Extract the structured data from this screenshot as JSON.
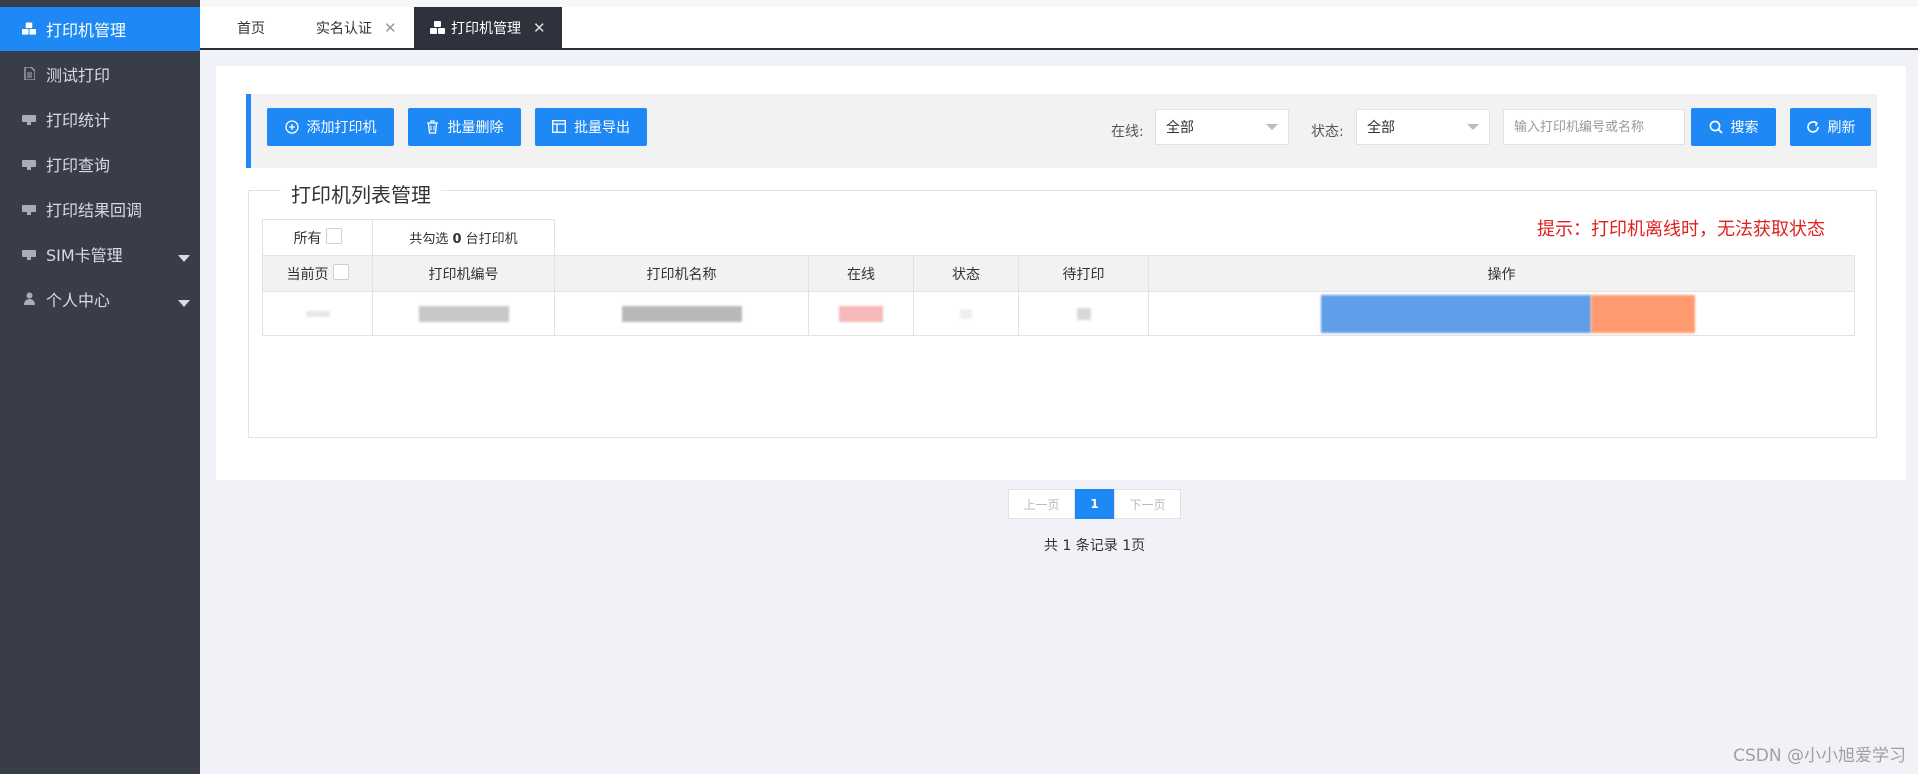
{
  "sidebar": {
    "items": [
      {
        "label": "打印机管理",
        "icon": "cubes-icon",
        "active": true
      },
      {
        "label": "测试打印",
        "icon": "file-icon"
      },
      {
        "label": "打印统计",
        "icon": "printer-icon"
      },
      {
        "label": "打印查询",
        "icon": "printer-icon"
      },
      {
        "label": "打印结果回调",
        "icon": "printer-icon"
      },
      {
        "label": "SIM卡管理",
        "icon": "printer-icon",
        "expandable": true
      },
      {
        "label": "个人中心",
        "icon": "user-icon",
        "expandable": true
      }
    ]
  },
  "tabs": [
    {
      "label": "首页"
    },
    {
      "label": "实名认证",
      "closable": true
    },
    {
      "label": "打印机管理",
      "closable": true,
      "active": true
    }
  ],
  "toolbar": {
    "add_label": "添加打印机",
    "delete_label": "批量删除",
    "export_label": "批量导出",
    "online_label": "在线:",
    "online_value": "全部",
    "status_label": "状态:",
    "status_value": "全部",
    "search_placeholder": "输入打印机编号或名称",
    "search_label": "搜索",
    "refresh_label": "刷新"
  },
  "panel": {
    "title": "打印机列表管理",
    "hint": "提示：打印机离线时，无法获取状态"
  },
  "table": {
    "all_label": "所有",
    "selected_prefix": "共勾选",
    "selected_count": "0",
    "selected_suffix": "台打印机",
    "headers": [
      "当前页",
      "打印机编号",
      "打印机名称",
      "在线",
      "状态",
      "待打印",
      "操作"
    ]
  },
  "pager": {
    "prev": "上一页",
    "current": "1",
    "next": "下一页",
    "total": "共 1 条记录 1页"
  },
  "watermark": "CSDN @小小旭爱学习",
  "colors": {
    "accent": "#1e88f5",
    "sidebar": "#393d49",
    "danger": "#e02020",
    "orange": "#ff7043"
  }
}
